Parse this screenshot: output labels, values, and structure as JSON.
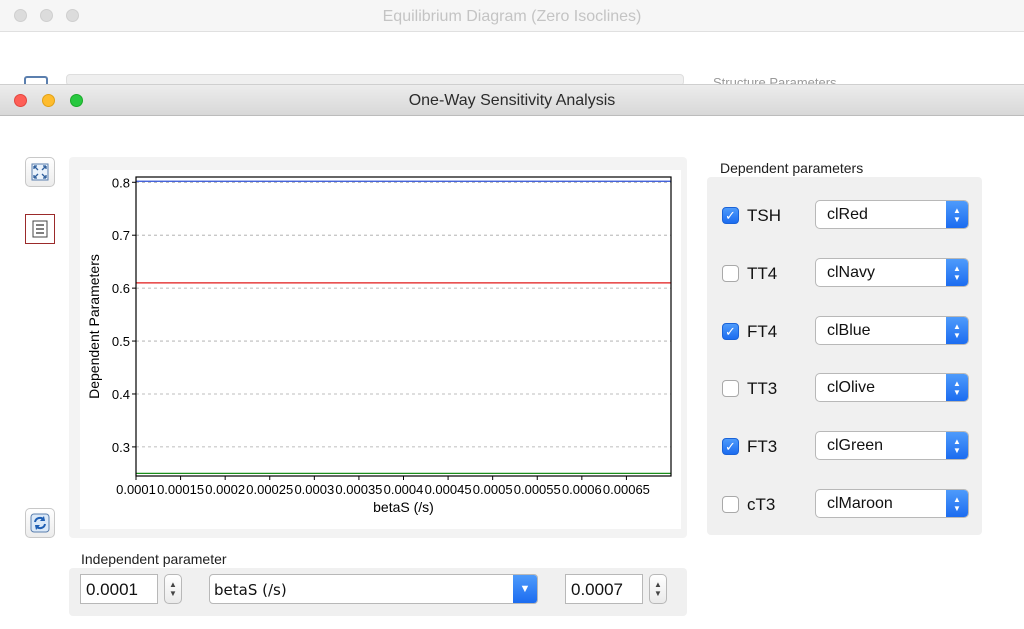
{
  "background_window": {
    "title": "Equilibrium Diagram (Zero Isoclines)",
    "panel_label": "Structure Parameters"
  },
  "window": {
    "title": "One-Way Sensitivity Analysis"
  },
  "toolbar": {
    "icons": [
      "zoom-fullscreen-icon",
      "legend-icon",
      "refresh-icon"
    ]
  },
  "chart_data": {
    "type": "line",
    "xlabel": "betaS (/s)",
    "ylabel": "Dependent Parameters",
    "xlim": [
      0.0001,
      0.0007
    ],
    "ylim": [
      0.245,
      0.81
    ],
    "x_ticks": [
      0.0001,
      0.00015,
      0.0002,
      0.00025,
      0.0003,
      0.00035,
      0.0004,
      0.00045,
      0.0005,
      0.00055,
      0.0006,
      0.00065
    ],
    "x_tick_labels": [
      "0.0001",
      "0.00015",
      "0.0002",
      "0.00025",
      "0.0003",
      "0.00035",
      "0.0004",
      "0.00045",
      "0.0005",
      "0.00055",
      "0.0006",
      "0.00065"
    ],
    "y_ticks": [
      0.3,
      0.4,
      0.5,
      0.6,
      0.7,
      0.8
    ],
    "y_tick_labels": [
      "0.3",
      "0.4",
      "0.5",
      "0.6",
      "0.7",
      "0.8"
    ],
    "grid": true,
    "legend": "none",
    "series": [
      {
        "color": "#2d4fd6",
        "x": [
          0.0001,
          0.0007
        ],
        "values": [
          0.802,
          0.802
        ]
      },
      {
        "color": "#e01818",
        "x": [
          0.0001,
          0.0007
        ],
        "values": [
          0.61,
          0.61
        ]
      },
      {
        "color": "#1a8f1a",
        "x": [
          0.0001,
          0.0007
        ],
        "values": [
          0.25,
          0.25
        ]
      }
    ]
  },
  "independent": {
    "label": "Independent parameter",
    "min_value": "0.0001",
    "parameter": "betaS (/s)",
    "max_value": "0.0007"
  },
  "dependent": {
    "label": "Dependent parameters",
    "items": [
      {
        "name": "TSH",
        "checked": true,
        "color": "clRed"
      },
      {
        "name": "TT4",
        "checked": false,
        "color": "clNavy"
      },
      {
        "name": "FT4",
        "checked": true,
        "color": "clBlue"
      },
      {
        "name": "TT3",
        "checked": false,
        "color": "clOlive"
      },
      {
        "name": "FT3",
        "checked": true,
        "color": "clGreen"
      },
      {
        "name": "cT3",
        "checked": false,
        "color": "clMaroon"
      }
    ]
  },
  "colors": {
    "accent": "#1c6cf0"
  }
}
